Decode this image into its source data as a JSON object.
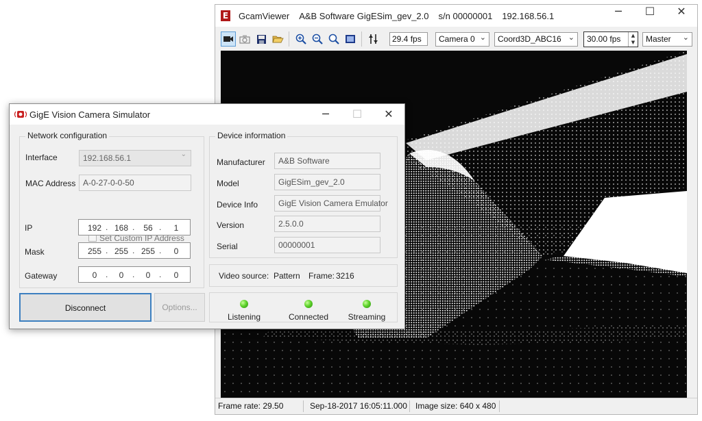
{
  "gcam": {
    "logo": "E",
    "title_app": "GcamViewer",
    "title_device": "A&B Software GigESim_gev_2.0",
    "title_serial": "s/n 00000001",
    "title_ip": "192.168.56.1",
    "window_min": "─",
    "window_max": "☐",
    "window_close": "✕",
    "toolbar": {
      "fps_readout": "29.4 fps",
      "camera_select": "Camera 0",
      "pixel_format": "Coord3D_ABC16",
      "frame_rate": "30.00 fps",
      "mode_select": "Master",
      "icons": [
        "camera-icon",
        "snapshot-icon",
        "save-icon",
        "open-folder-icon",
        "zoom-in-icon",
        "zoom-out-icon",
        "zoom-fit-icon",
        "display-icon",
        "adjust-icon"
      ]
    },
    "status": {
      "frame_rate": "Frame rate: 29.50",
      "timestamp": "Sep-18-2017 16:05:11.000",
      "image_size": "Image size:  640 x 480"
    }
  },
  "sim": {
    "title": "GigE Vision Camera Simulator",
    "network": {
      "group_title": "Network configuration",
      "interface_label": "Interface",
      "interface_value": "192.168.56.1",
      "mac_label": "MAC Address",
      "mac_value": "A-0-27-0-0-50",
      "custom_ip_label": "Set Custom IP Address",
      "ip_label": "IP",
      "ip": [
        "192",
        "168",
        "56",
        "1"
      ],
      "mask_label": "Mask",
      "mask": [
        "255",
        "255",
        "255",
        "0"
      ],
      "gateway_label": "Gateway",
      "gateway": [
        "0",
        "0",
        "0",
        "0"
      ],
      "dot": "."
    },
    "device": {
      "group_title": "Device information",
      "manufacturer_label": "Manufacturer",
      "manufacturer_value": "A&B Software",
      "model_label": "Model",
      "model_value": "GigESim_gev_2.0",
      "info_label": "Device Info",
      "info_value": "GigE Vision Camera Emulator",
      "version_label": "Version",
      "version_value": "2.5.0.0",
      "serial_label": "Serial",
      "serial_value": "00000001"
    },
    "video": {
      "source_label": "Video source:",
      "source_value": "Pattern",
      "frame_label": "Frame:",
      "frame_value": "3216"
    },
    "buttons": {
      "disconnect": "Disconnect",
      "options": "Options..."
    },
    "indicators": [
      {
        "label": "Listening",
        "color": "#4fc82a"
      },
      {
        "label": "Connected",
        "color": "#4fc82a"
      },
      {
        "label": "Streaming",
        "color": "#4fc82a"
      }
    ]
  }
}
